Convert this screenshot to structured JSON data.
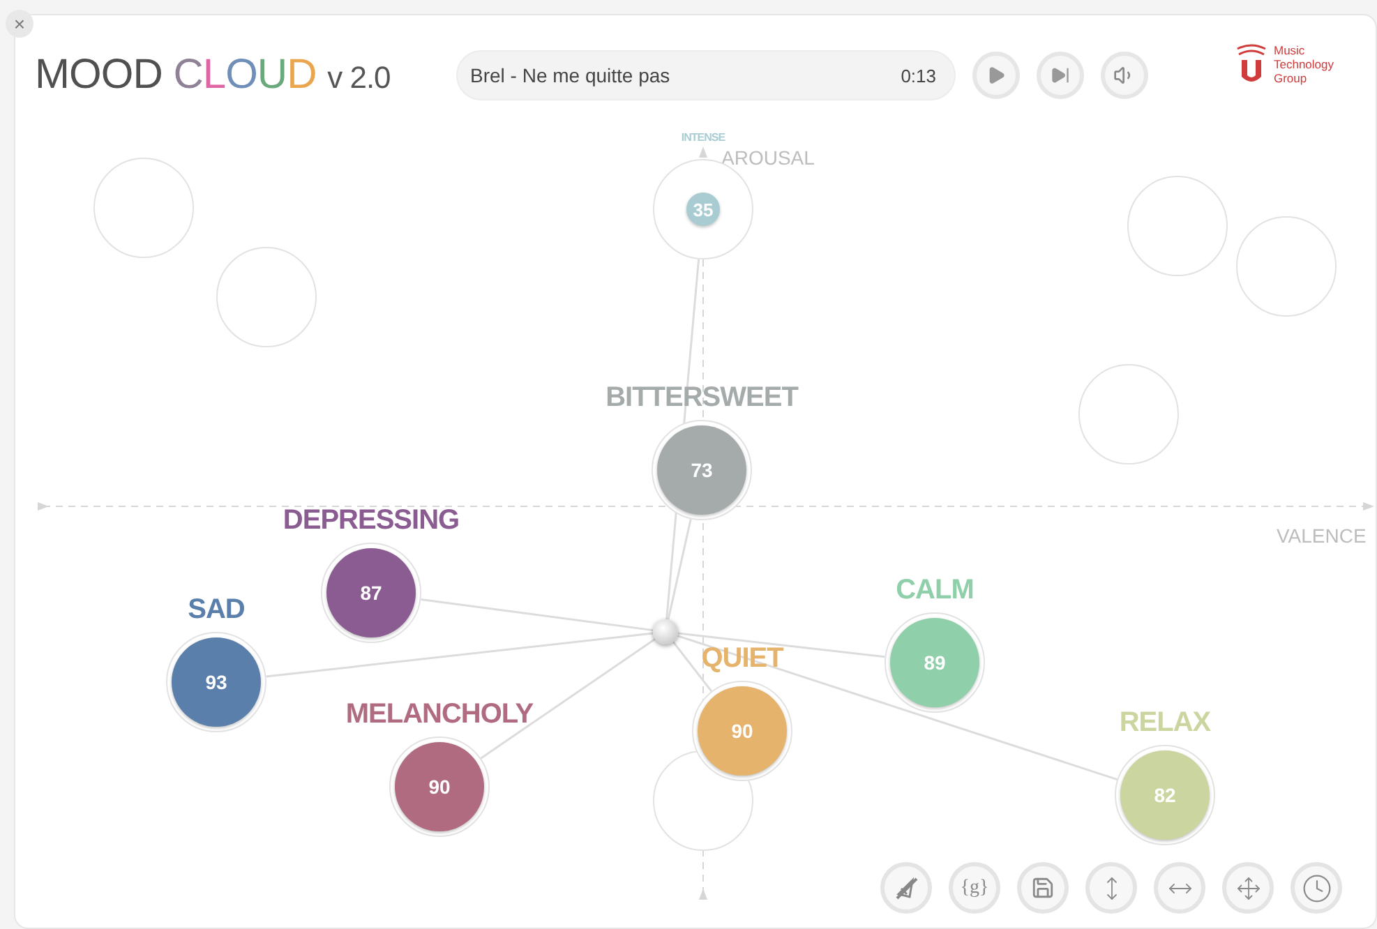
{
  "close_button": "×",
  "title": {
    "text": "MOOD CLOUD",
    "version": "v 2.0"
  },
  "player": {
    "track": "Brel - Ne me quitte pas",
    "time": "0:13",
    "controls": [
      {
        "kind": "play"
      },
      {
        "kind": "next"
      },
      {
        "kind": "volume"
      }
    ]
  },
  "logo": {
    "lines": [
      "Music",
      "Technology",
      "Group"
    ]
  },
  "axes": {
    "vertical_label": "AROUSAL",
    "horizontal_label": "VALENCE"
  },
  "nodes": [
    {
      "kind": "minor",
      "label": "INTENSE",
      "value": "35",
      "color": "#a9ccd3"
    },
    {
      "kind": "mood",
      "label": "BITTERSWEET",
      "value": "73",
      "color": "#a5abab"
    },
    {
      "kind": "mood",
      "label": "DEPRESSING",
      "value": "87",
      "color": "#8a5c91"
    },
    {
      "kind": "mood",
      "label": "SAD",
      "value": "93",
      "color": "#5a7fab"
    },
    {
      "kind": "mood",
      "label": "MELANCHOLY",
      "value": "90",
      "color": "#b06b80"
    },
    {
      "kind": "mood",
      "label": "QUIET",
      "value": "90",
      "color": "#e6b36d"
    },
    {
      "kind": "mood",
      "label": "CALM",
      "value": "89",
      "color": "#8fcfa9"
    },
    {
      "kind": "mood",
      "label": "RELAX",
      "value": "82",
      "color": "#cbd5a0"
    },
    {
      "kind": "empty"
    },
    {
      "kind": "empty"
    },
    {
      "kind": "empty"
    },
    {
      "kind": "empty"
    },
    {
      "kind": "empty"
    },
    {
      "kind": "empty"
    }
  ],
  "toolbar": [
    {
      "kind": "mute-shape"
    },
    {
      "kind": "text",
      "label": "{g}"
    },
    {
      "kind": "save"
    },
    {
      "kind": "vertical"
    },
    {
      "kind": "horizontal"
    },
    {
      "kind": "both"
    },
    {
      "kind": "clock"
    }
  ]
}
